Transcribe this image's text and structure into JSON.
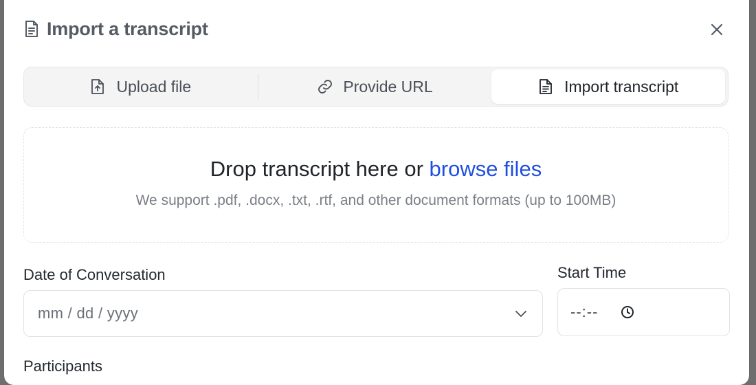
{
  "modal": {
    "title": "Import a transcript",
    "title_icon": "document-icon",
    "close_icon": "close-icon"
  },
  "tabs": [
    {
      "label": "Upload file",
      "icon": "upload-file-icon",
      "active": false
    },
    {
      "label": "Provide URL",
      "icon": "link-icon",
      "active": false
    },
    {
      "label": "Import transcript",
      "icon": "document-icon",
      "active": true
    }
  ],
  "dropzone": {
    "prefix": "Drop transcript here or ",
    "browse_label": "browse files",
    "support_text": "We support .pdf, .docx, .txt, .rtf, and other document formats (up to 100MB)"
  },
  "form": {
    "date_label": "Date of Conversation",
    "date_placeholder": "mm / dd / yyyy",
    "start_time_label": "Start Time",
    "time_placeholder": "--:--",
    "participants_label": "Participants"
  },
  "colors": {
    "accent": "#1f4fe0",
    "title": "#555b63",
    "overlay": "#6e6e6e"
  }
}
